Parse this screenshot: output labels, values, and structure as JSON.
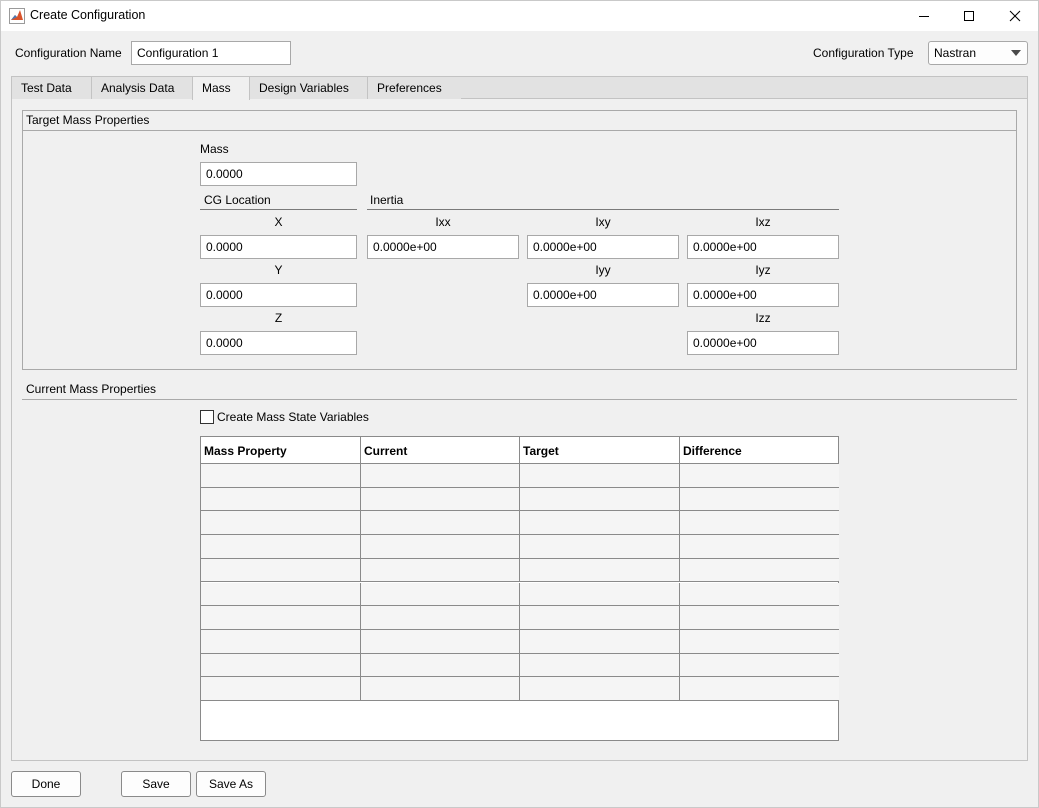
{
  "window": {
    "title": "Create Configuration",
    "controls": {
      "minimize": "minimize-icon",
      "maximize": "maximize-icon",
      "close": "close-icon"
    }
  },
  "config": {
    "name_label": "Configuration Name",
    "name_value": "Configuration 1",
    "type_label": "Configuration Type",
    "type_value": "Nastran"
  },
  "tabs": [
    {
      "label": "Test Data",
      "active": false
    },
    {
      "label": "Analysis Data",
      "active": false
    },
    {
      "label": "Mass",
      "active": true
    },
    {
      "label": "Design Variables",
      "active": false
    },
    {
      "label": "Preferences",
      "active": false
    }
  ],
  "target": {
    "title": "Target Mass Properties",
    "mass_label": "Mass",
    "mass_value": "0.0000",
    "cg_label": "CG Location",
    "inertia_label": "Inertia",
    "x_label": "X",
    "x_value": "0.0000",
    "y_label": "Y",
    "y_value": "0.0000",
    "z_label": "Z",
    "z_value": "0.0000",
    "ixx_label": "Ixx",
    "ixx_value": "0.0000e+00",
    "ixy_label": "Ixy",
    "ixy_value": "0.0000e+00",
    "ixz_label": "Ixz",
    "ixz_value": "0.0000e+00",
    "iyy_label": "Iyy",
    "iyy_value": "0.0000e+00",
    "iyz_label": "Iyz",
    "iyz_value": "0.0000e+00",
    "izz_label": "Izz",
    "izz_value": "0.0000e+00"
  },
  "current": {
    "title": "Current Mass Properties",
    "checkbox_label": "Create Mass State Variables",
    "checkbox_checked": false,
    "columns": [
      "Mass Property",
      "Current",
      "Target",
      "Difference"
    ],
    "row_count": 10
  },
  "buttons": {
    "done": "Done",
    "save": "Save",
    "save_as": "Save As"
  },
  "colors": {
    "background": "#f0f0f0",
    "field_border": "#a8a8a8",
    "icon_accent": "#d9532b"
  }
}
